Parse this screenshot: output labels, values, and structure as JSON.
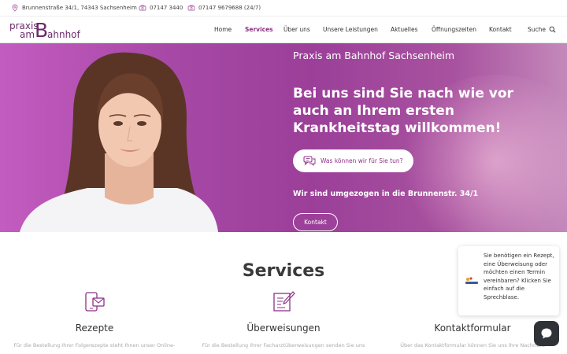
{
  "topbar": {
    "address": "Brunnenstraße 34/1, 74343 Sachsenheim",
    "phone": "07147 3440",
    "emergency": "07147 9679688 (24/7)"
  },
  "logo": {
    "part1": "praxis",
    "part2": "am",
    "part3": "B",
    "part4": "ahnhof"
  },
  "nav": {
    "items": [
      "Home",
      "Services",
      "Über uns",
      "Unsere Leistungen",
      "Aktuelles",
      "Öffnungszeiten",
      "Kontakt"
    ],
    "search_label": "Suche"
  },
  "hero": {
    "subtitle": "Praxis am Bahnhof Sachsenheim",
    "title": "Bei uns sind Sie nach wie vor auch an Ihrem ersten Krankheitstag willkommen!",
    "ask_button": "Was können wir für Sie tun?",
    "moved_note": "Wir sind umgezogen in die Brunnenstr. 34/1",
    "contact_button": "Kontakt"
  },
  "services": {
    "heading": "Services",
    "items": [
      {
        "title": "Rezepte",
        "desc": "Für die Bestellung Ihrer Folgerezepte steht Ihnen unser Online-"
      },
      {
        "title": "Überweisungen",
        "desc": "Für die Bestellung Ihrer Facharztüberweisungen senden Sie uns"
      },
      {
        "title": "Kontaktformular",
        "desc": "Über das Kontaktformular können Sie uns Ihre Nachricht"
      }
    ]
  },
  "chat_popup": {
    "text": "Sie benötigen ein Rezept, eine Überweisung oder möchten einen Termin vereinbaren? Klicken Sie einfach auf die Sprechblase."
  },
  "colors": {
    "accent": "#8e2f86",
    "hero": "#a748a6",
    "chat": "#2f3338"
  }
}
